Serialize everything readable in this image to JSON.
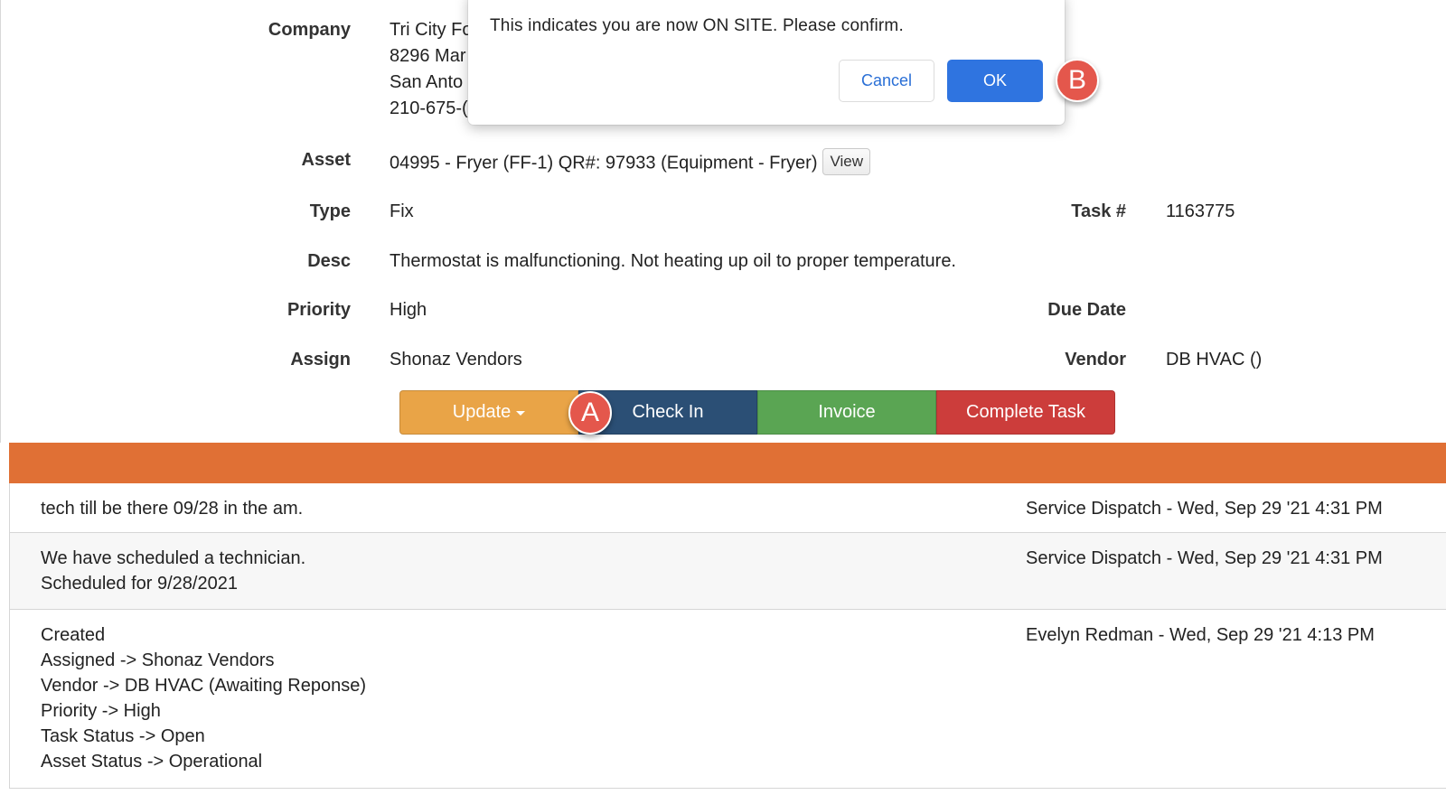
{
  "details": {
    "company_label": "Company",
    "company_lines": [
      "Tri City Fo",
      "8296 Mar",
      "San Anto",
      "210-675-("
    ],
    "asset_label": "Asset",
    "asset_value": "04995 - Fryer (FF-1) QR#: 97933 (Equipment - Fryer)",
    "view_label": "View",
    "type_label": "Type",
    "type_value": "Fix",
    "task_label": "Task #",
    "task_value": "1163775",
    "desc_label": "Desc",
    "desc_value": "Thermostat is malfunctioning. Not heating up oil to proper temperature.",
    "priority_label": "Priority",
    "priority_value": "High",
    "due_label": "Due Date",
    "due_value": "",
    "assign_label": "Assign",
    "assign_value": "Shonaz Vendors",
    "vendor_label": "Vendor",
    "vendor_value": "DB HVAC ()"
  },
  "actions": {
    "update": "Update",
    "checkin": "Check In",
    "invoice": "Invoice",
    "complete": "Complete Task"
  },
  "log": [
    {
      "lines": [
        "tech till be there 09/28 in the am."
      ],
      "meta": "Service Dispatch - Wed, Sep 29 '21 4:31 PM"
    },
    {
      "lines": [
        "We have scheduled a technician.",
        "Scheduled for 9/28/2021"
      ],
      "meta": "Service Dispatch - Wed, Sep 29 '21 4:31 PM"
    },
    {
      "lines": [
        "Created",
        "Assigned -> Shonaz Vendors",
        "Vendor -> DB HVAC (Awaiting Reponse)",
        "Priority -> High",
        "Task Status -> Open",
        "Asset Status -> Operational"
      ],
      "meta": "Evelyn Redman - Wed, Sep 29 '21 4:13 PM"
    }
  ],
  "modal": {
    "message": "This indicates you are now ON SITE. Please confirm.",
    "cancel": "Cancel",
    "ok": "OK"
  },
  "markers": {
    "a": "A",
    "b": "B"
  },
  "colors": {
    "update": "#e9a447",
    "checkin": "#2b4f75",
    "invoice": "#5aa553",
    "complete": "#cc3d3b",
    "band": "#e07035",
    "ok": "#2f74e0",
    "marker": "#e4574c"
  }
}
